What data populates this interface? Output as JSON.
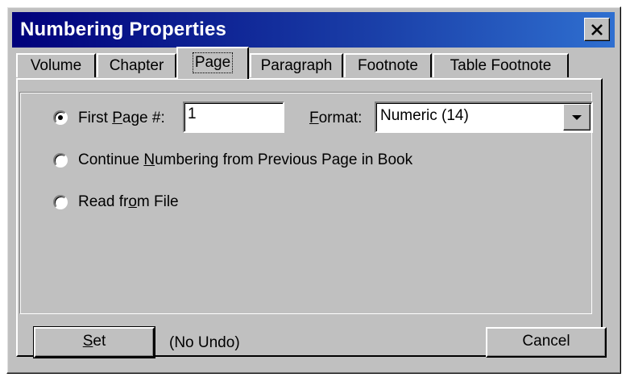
{
  "dialog": {
    "title": "Numbering Properties"
  },
  "tabs": [
    {
      "label": "Volume"
    },
    {
      "label": "Chapter"
    },
    {
      "label": "Page"
    },
    {
      "label": "Paragraph"
    },
    {
      "label": "Footnote"
    },
    {
      "label": "Table Footnote"
    }
  ],
  "active_tab": "Page",
  "options": {
    "first_page": {
      "label_pre": "First ",
      "label_key": "P",
      "label_post": "age #:",
      "value": "1",
      "selected": true
    },
    "continue": {
      "label_pre": "Continue ",
      "label_key": "N",
      "label_post": "umbering from Previous Page in Book",
      "selected": false
    },
    "read_file": {
      "label_pre": "Read fr",
      "label_key": "o",
      "label_post": "m File",
      "selected": false
    }
  },
  "format": {
    "label_key": "F",
    "label_post": "ormat:",
    "value": "Numeric  (14)"
  },
  "footer": {
    "set_key": "S",
    "set_post": "et",
    "no_undo": "(No Undo)",
    "cancel": "Cancel"
  }
}
